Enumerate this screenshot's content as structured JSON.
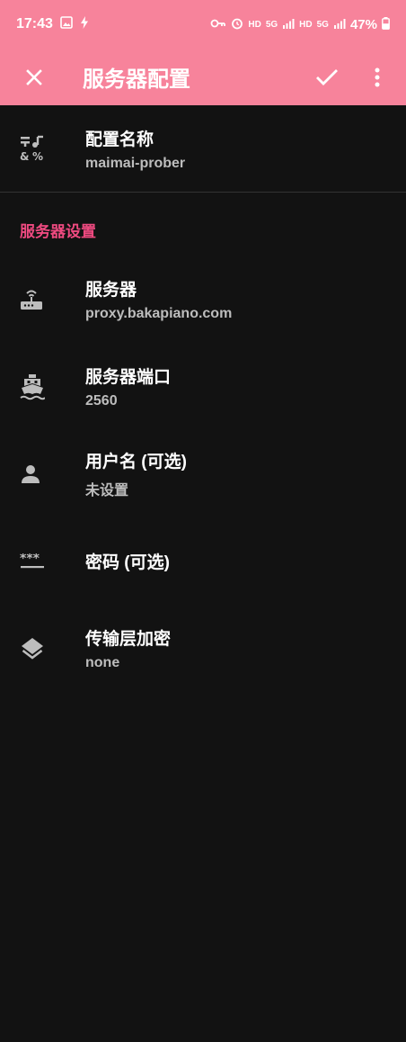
{
  "status": {
    "time": "17:43",
    "battery": "47%",
    "network_labels": [
      "HD",
      "5G",
      "HD",
      "5G"
    ]
  },
  "appbar": {
    "title": "服务器配置",
    "icons": [
      "close-icon",
      "check-icon",
      "more-vert-icon"
    ]
  },
  "config_name": {
    "title": "配置名称",
    "value": "maimai-prober",
    "icon": "symbols-icon"
  },
  "section": {
    "title": "服务器设置"
  },
  "items": [
    {
      "title": "服务器",
      "value": "proxy.bakapiano.com",
      "icon": "router-icon"
    },
    {
      "title": "服务器端口",
      "value": "2560",
      "icon": "ship-icon"
    },
    {
      "title": "用户名 (可选)",
      "value": "未设置",
      "icon": "person-icon"
    },
    {
      "title": "密码 (可选)",
      "value": "",
      "icon": "password-icon"
    },
    {
      "title": "传输层加密",
      "value": "none",
      "icon": "layers-icon"
    }
  ],
  "colors": {
    "accent": "#f7839b",
    "section_title": "#ee4a80",
    "background": "#121212",
    "icon": "#bdbdbd"
  }
}
